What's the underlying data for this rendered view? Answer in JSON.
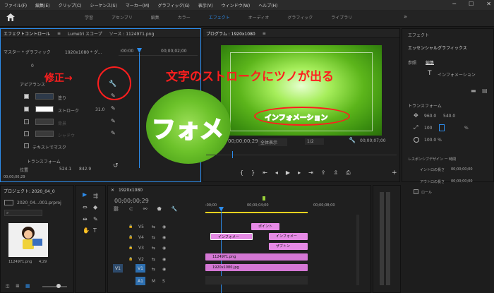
{
  "menu": [
    "ファイル(F)",
    "編集(E)",
    "クリップ(C)",
    "シーケンス(S)",
    "マーカー(M)",
    "グラフィック(G)",
    "表示(V)",
    "ウィンドウ(W)",
    "ヘルプ(H)"
  ],
  "window_buttons": [
    "─",
    "☐",
    "✕"
  ],
  "workspaces": [
    "学習",
    "アセンブリ",
    "編集",
    "カラー",
    "エフェクト",
    "オーディオ",
    "グラフィック",
    "ライブラリ"
  ],
  "workspace_active": "エフェクト",
  "workspace_more": "»",
  "effect_controls": {
    "tabs": [
      "エフェクトコントロール",
      "Lumetri スコープ",
      "ソース : 1124971.png"
    ],
    "master": "マスター * グラフィック",
    "clip": "1920x1080 * グ...",
    "time_start": ":00:00",
    "time_end": "00;00;02;00",
    "value_0": "0",
    "appearance_label": "アピアランス",
    "fill_label": "塗り",
    "stroke_label": "ストローク",
    "stroke_value": "31.0",
    "bg_label": "背景",
    "shadow_label": "シャドウ",
    "mask_label": "テキストでマスク",
    "transform_label": "トランスフォーム",
    "position_label": "位置",
    "pos_x": "524.1",
    "pos_y": "842.9",
    "timecode": "00;00;00;29"
  },
  "annotation": {
    "fix_label": "修正→",
    "headline": "文字のストロークにツノが出る",
    "zoom_text": "フォメ",
    "preview_text": "インフォメーション"
  },
  "program": {
    "title": "プログラム : 1920x1080",
    "timecode": "00;00;00;29",
    "fit": "全体表示",
    "resolution": "1/2",
    "duration": "00;00;07;00"
  },
  "essential_graphics": {
    "tab": "エフェクト",
    "title": "エッセンシャルグラフィックス",
    "subtabs": [
      "参照",
      "編集"
    ],
    "layer_name": "インフォメーション",
    "transform_label": "トランスフォーム",
    "pos_x": "960.0",
    "pos_y": "540.0",
    "scale": "100",
    "opacity": "100.0 %",
    "responsive_label": "レスポンシブデザイン ー 時間",
    "intro_label": "イントロの長さ",
    "intro_value": "00;00;00;00",
    "outro_label": "アウトロの長さ",
    "outro_value": "00;00;00;00",
    "roll_label": "ロール"
  },
  "project": {
    "title": "プロジェクト: 2020_04_0",
    "file": "2020_04...001.prproj",
    "thumb_name": "1124971.png",
    "thumb_duration": "4;29"
  },
  "timeline": {
    "title": "1920x1080",
    "timecode": "00;00;00;29",
    "ruler": [
      ":00;00",
      "00;00;04;00",
      "00;00;08;00"
    ],
    "tracks": [
      "V5",
      "V4",
      "V3",
      "V2",
      "V1",
      "A1"
    ],
    "clips": [
      {
        "label": "ポイント"
      },
      {
        "label": "インフォメー"
      },
      {
        "label": "インフォメー"
      },
      {
        "label": "ザブトン"
      },
      {
        "label": "1124971.png"
      },
      {
        "label": "1920x1080.jpg"
      }
    ]
  },
  "tool_glyphs": [
    "▶",
    "⇔",
    "◆",
    "⇹",
    "✎",
    "✋",
    "T"
  ],
  "colors": {
    "accent": "#2d8ceb",
    "annotation_red": "#ff1e1e",
    "clip_pink": "#e58ae5",
    "green": "#6fcf22",
    "playhead": "#2d8ceb"
  }
}
